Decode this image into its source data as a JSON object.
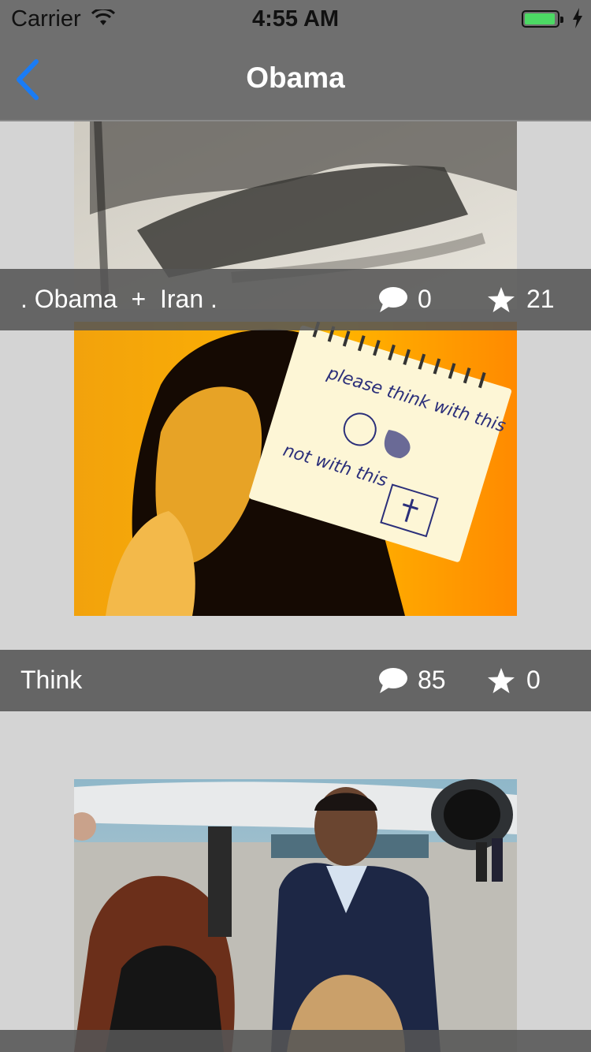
{
  "status_bar": {
    "carrier": "Carrier",
    "time": "4:55 AM",
    "battery_level": 0.86
  },
  "nav": {
    "title": "Obama",
    "back_icon": "chevron-left-icon"
  },
  "colors": {
    "accent": "#1a7cf5",
    "nav_bg": "#6f6f6f",
    "caption_bg": "#555555",
    "page_bg": "#d4d4d4",
    "battery": "#4cd964"
  },
  "posts": [
    {
      "title": ". Obama  +  Iran .",
      "comments": "0",
      "stars": "21",
      "image": "charcoal-sketch-portrait"
    },
    {
      "title": "Think",
      "comments": "85",
      "stars": "0",
      "image": "woman-with-notebook",
      "image_text": [
        "please think with this",
        "not with this"
      ]
    },
    {
      "title": "",
      "comments": "",
      "stars": "",
      "image": "obama-at-airport"
    }
  ],
  "icons": {
    "comment": "speech-bubble-icon",
    "star": "star-icon"
  }
}
